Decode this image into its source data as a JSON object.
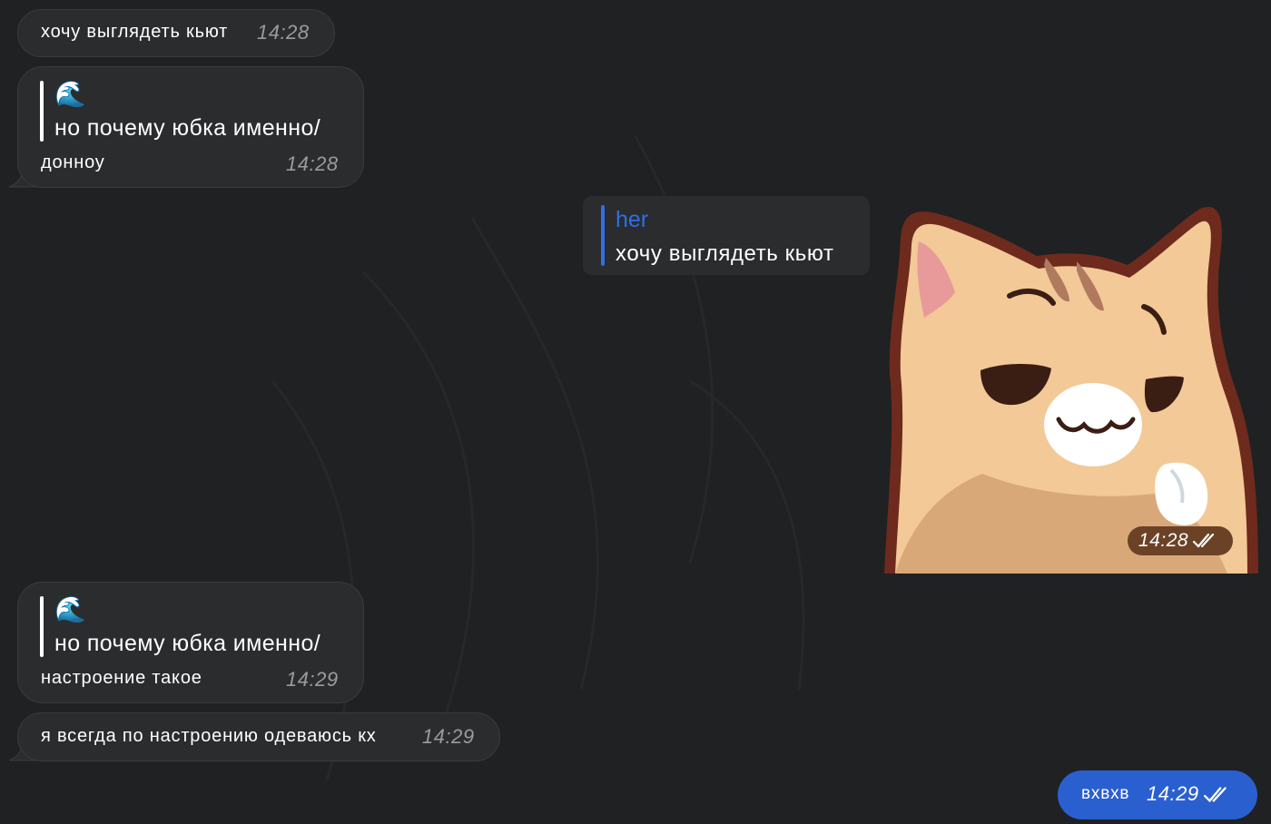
{
  "messages": [
    {
      "text": "хочу выглядеть кьют",
      "time": "14:28"
    },
    {
      "quote_icon": "🌊",
      "quote_text": "но почему юбка именно/",
      "text": "донноу",
      "time": "14:28"
    },
    {
      "reply_author": "her",
      "reply_text": "хочу выглядеть кьют",
      "sticker": "cat-sticker",
      "time": "14:28"
    },
    {
      "quote_icon": "🌊",
      "quote_text": "но почему юбка именно/",
      "text": "настроение такое",
      "time": "14:29"
    },
    {
      "text": "я всегда по настроению одеваюсь кх",
      "time": "14:29"
    },
    {
      "text": "вхвхв",
      "time": "14:29"
    }
  ],
  "colors": {
    "background": "#1f2123",
    "incoming_bubble": "#2b2c2e",
    "outgoing_bubble": "#2a5fd0",
    "accent": "#2f6fe6",
    "sticker_time_badge": "#6b4226"
  },
  "icons": {
    "read_status": "double-check-icon",
    "quote_emoji": "wave-icon"
  }
}
